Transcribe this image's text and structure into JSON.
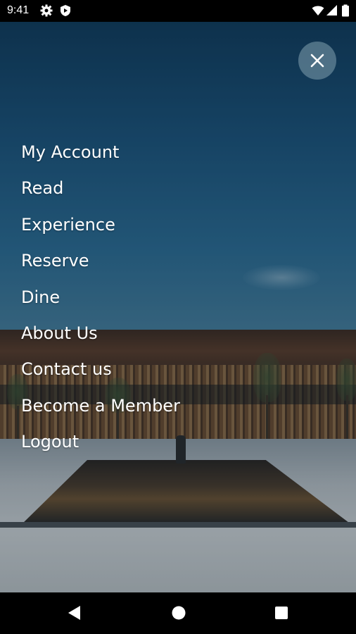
{
  "status_bar": {
    "time": "9:41",
    "left_icons": [
      "gear-icon",
      "shield-icon"
    ],
    "right_icons": [
      "wifi-icon",
      "signal-icon",
      "battery-icon"
    ]
  },
  "close_button": {
    "icon": "close-icon",
    "label": "Close menu"
  },
  "menu": {
    "items": [
      {
        "label": "My Account"
      },
      {
        "label": "Read"
      },
      {
        "label": "Experience"
      },
      {
        "label": "Reserve"
      },
      {
        "label": "Dine"
      },
      {
        "label": "About Us"
      },
      {
        "label": "Contact us"
      },
      {
        "label": "Become a Member"
      },
      {
        "label": "Logout"
      }
    ]
  },
  "nav_bar": {
    "buttons": [
      "back-icon",
      "home-icon",
      "recents-icon"
    ]
  }
}
